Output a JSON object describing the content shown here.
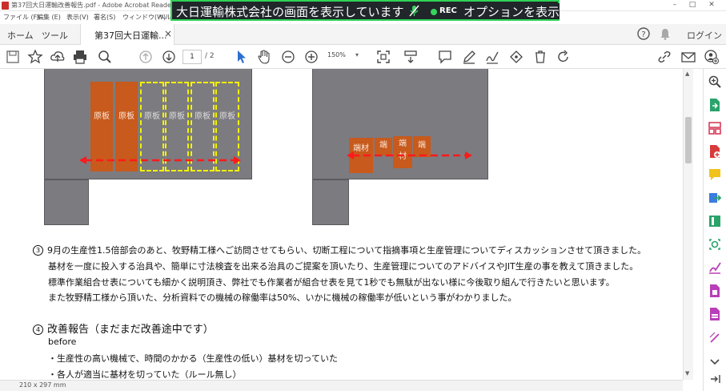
{
  "window": {
    "title": "第37回大日運輸改善報告.pdf - Adobe Acrobat Reader DC"
  },
  "menu": [
    "ファイル (F)",
    "編集 (E)",
    "表示(V)",
    "署名(S)",
    "ウィンドウ(W)",
    "ヘルプ(H)"
  ],
  "share_banner": {
    "message": "大日運輸株式会社の画面を表示しています",
    "rec": "REC",
    "options": "オプションを表示"
  },
  "tabs": {
    "home": "ホーム",
    "tools": "ツール",
    "document": "第37回大日運輸...",
    "close": "×",
    "login": "ログイン"
  },
  "toolbar": {
    "page_current": "1",
    "page_total": "/ 2",
    "zoom": "150%"
  },
  "figure": {
    "plate_label": "原板",
    "scrap_label": "端材",
    "scrap_short": "端",
    "scrap_rest": "材"
  },
  "content": {
    "item3_num": "3",
    "item3_lines": [
      "9月の生産性1.5倍部会のあと、牧野精工様へご訪問させてもらい、切断工程について指摘事項と生産管理についてディスカッションさせて頂きました。",
      "基材を一度に投入する治具や、簡単に寸法検査を出来る治具のご提案を頂いたり、生産管理についてのアドバイスやJIT生産の事を教えて頂きました。",
      "標準作業組合せ表についても細かく説明頂き、弊社でも作業者が組合せ表を見て1秒でも無駄が出ない様に今後取り組んで行きたいと思います。",
      "また牧野精工様から頂いた、分析資料での機械の稼働率は50%、いかに機械の稼働率が低いという事がわかりました。"
    ],
    "item4_num": "4",
    "item4_title": "改善報告（まだまだ改善途中です）",
    "item4_sub": "before",
    "item4_bullets": [
      "・生産性の高い機械で、時間のかかる（生産性の低い）基材を切っていた",
      "・各人が適当に基材を切っていた（ルール無し）"
    ]
  },
  "status": {
    "page_size": "210 x 297 mm"
  },
  "colors": {
    "banner_border": "#2fd256",
    "plate": "#c75a1c",
    "dashed_outline": "#f3f300",
    "arrow": "#ff1a1a",
    "figure_bg": "#7c7b80"
  },
  "icons": {
    "toolbar": [
      "save-icon",
      "bookmark-star-icon",
      "upload-icon",
      "print-icon",
      "search-zoom-icon",
      "page-up-icon",
      "page-down-icon",
      "select-cursor-icon",
      "hand-icon",
      "zoom-out-icon",
      "zoom-in-icon",
      "fit-page-icon",
      "scroll-mode-icon",
      "comment-icon",
      "highlight-pen-icon",
      "sign-icon",
      "stamp-icon",
      "delete-icon",
      "rotate-icon",
      "link-icon",
      "mail-icon",
      "add-user-icon"
    ],
    "right_pane": [
      "zoom-search-icon",
      "export-pdf-icon",
      "organize-icon",
      "create-pdf-icon",
      "comment-icon",
      "send-icon",
      "edit-icon",
      "enhance-icon",
      "fill-sign-icon",
      "protect-icon",
      "pdf-icon",
      "measure-icon",
      "more-tools-icon",
      "collapse-pane-icon"
    ]
  }
}
